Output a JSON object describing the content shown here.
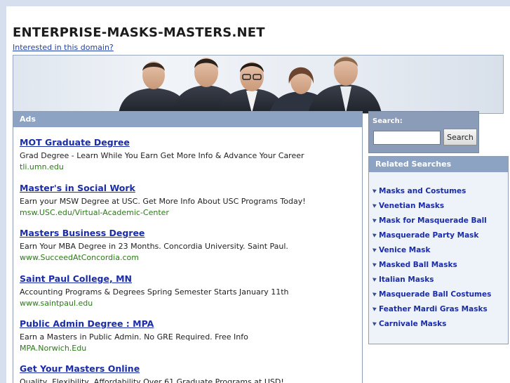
{
  "header": {
    "site_title": "ENTERPRISE-MASKS-MASTERS.NET",
    "domain_link": "Interested in this domain?"
  },
  "banner": {
    "image": "business-team-photo"
  },
  "ads": {
    "header": "Ads",
    "items": [
      {
        "title": "MOT Graduate Degree",
        "desc": "Grad Degree - Learn While You Earn Get More Info & Advance Your Career",
        "url": "tli.umn.edu"
      },
      {
        "title": "Master's in Social Work",
        "desc": "Earn your MSW Degree at USC. Get More Info About USC Programs Today!",
        "url": "msw.USC.edu/Virtual-Academic-Center"
      },
      {
        "title": "Masters Business Degree",
        "desc": "Earn Your MBA Degree in 23 Months. Concordia University. Saint Paul.",
        "url": "www.SucceedAtConcordia.com"
      },
      {
        "title": "Saint Paul College, MN",
        "desc": "Accounting Programs & Degrees Spring Semester Starts January 11th",
        "url": "www.saintpaul.edu"
      },
      {
        "title": "Public Admin Degree : MPA",
        "desc": "Earn a Masters in Public Admin. No GRE Required. Free Info",
        "url": "MPA.Norwich.Edu"
      },
      {
        "title": "Get Your Masters Online",
        "desc": "Quality, Flexibility, Affordability Over 61 Graduate Programs at USD!",
        "url": ""
      }
    ]
  },
  "search": {
    "label": "Search:",
    "input_value": "",
    "button_label": "Search"
  },
  "related": {
    "header": "Related Searches",
    "items": [
      "Masks and Costumes",
      "Venetian Masks",
      "Mask for Masquerade Ball",
      "Masquerade Party Mask",
      "Venice Mask",
      "Masked Ball Masks",
      "Italian Masks",
      "Masquerade Ball Costumes",
      "Feather Mardi Gras Masks",
      "Carnivale Masks"
    ]
  },
  "colors": {
    "page_background": "#d5dfed",
    "panel_header": "#8ca3c4",
    "link": "#1a2ca8",
    "ad_url": "#2a7a16"
  }
}
